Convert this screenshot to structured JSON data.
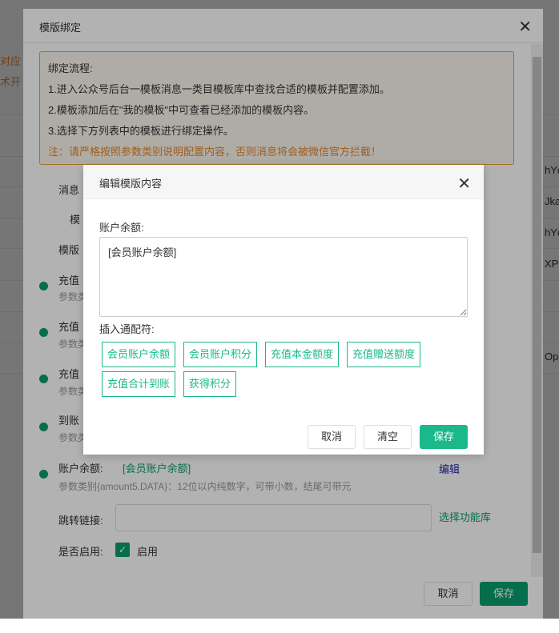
{
  "background": {
    "left_texts": [
      "对应",
      "术开"
    ],
    "right_texts": [
      "hYc",
      "Jka",
      "hYc",
      "XPI",
      "Op"
    ]
  },
  "outer_dialog": {
    "title": "模版绑定",
    "notice": {
      "heading": "绑定流程:",
      "steps": [
        "1.进入公众号后台一模板消息一类目模板库中查找合适的模板并配置添加。",
        "2.模板添加后在\"我的模板\"中可查看已经添加的模板内容。",
        "3.选择下方列表中的模板进行绑定操作。"
      ],
      "warning": "注：请严格按照参数类别说明配置内容，否则消息将会被微信官方拦截！"
    },
    "partial_labels": [
      "消息",
      "模",
      "模版"
    ],
    "fields": [
      {
        "label": "充值",
        "desc": "参数类"
      },
      {
        "label": "充值",
        "desc": "参数类"
      },
      {
        "label": "充值",
        "desc": "参数类"
      },
      {
        "label": "到账",
        "desc": "参数类"
      },
      {
        "label": "账户余额:",
        "value": "[会员账户余额]",
        "desc": "参数类别{amount5.DATA}：12位以内纯数字，可带小数，结尾可带元",
        "edit": "编辑"
      }
    ],
    "jump_link": {
      "label": "跳转链接:",
      "value": "",
      "select": "选择功能库"
    },
    "enable": {
      "label": "是否启用:",
      "checkbox": "启用",
      "checked": true
    },
    "cancel": "取消",
    "save": "保存"
  },
  "modal": {
    "title": "编辑模版内容",
    "field_label": "账户余额:",
    "content": "[会员账户余额]",
    "insert_label": "插入通配符:",
    "tags": [
      "会员账户余额",
      "会员账户积分",
      "充值本金额度",
      "充值赠送额度",
      "充值合计到账",
      "获得积分"
    ],
    "cancel": "取消",
    "clear": "清空",
    "save": "保存"
  },
  "colors": {
    "accent": "#1ab88a",
    "warning": "#e6862c",
    "link": "#2222aa"
  }
}
